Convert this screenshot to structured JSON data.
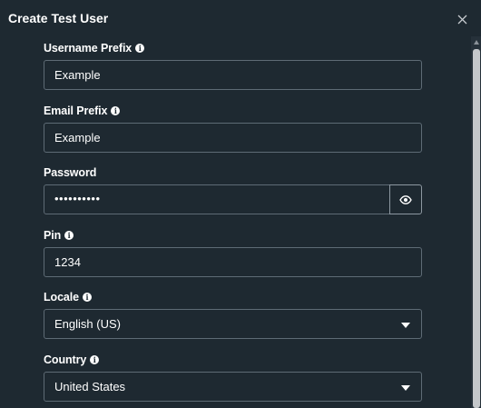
{
  "dialog": {
    "title": "Create Test User",
    "close_label": "×"
  },
  "icons": {
    "info": "info-icon",
    "close": "close-icon",
    "eye": "eye-icon",
    "dropdown": "caret-down-icon"
  },
  "colors": {
    "background": "#1e2931",
    "input_border": "#5e6b75",
    "text": "#ffffff"
  },
  "form": {
    "username_prefix": {
      "label": "Username Prefix",
      "value": "Example"
    },
    "email_prefix": {
      "label": "Email Prefix",
      "value": "Example"
    },
    "password": {
      "label": "Password",
      "value": "••••••••••"
    },
    "pin": {
      "label": "Pin",
      "value": "1234"
    },
    "locale": {
      "label": "Locale",
      "value": "English (US)"
    },
    "country": {
      "label": "Country",
      "value": "United States"
    }
  }
}
